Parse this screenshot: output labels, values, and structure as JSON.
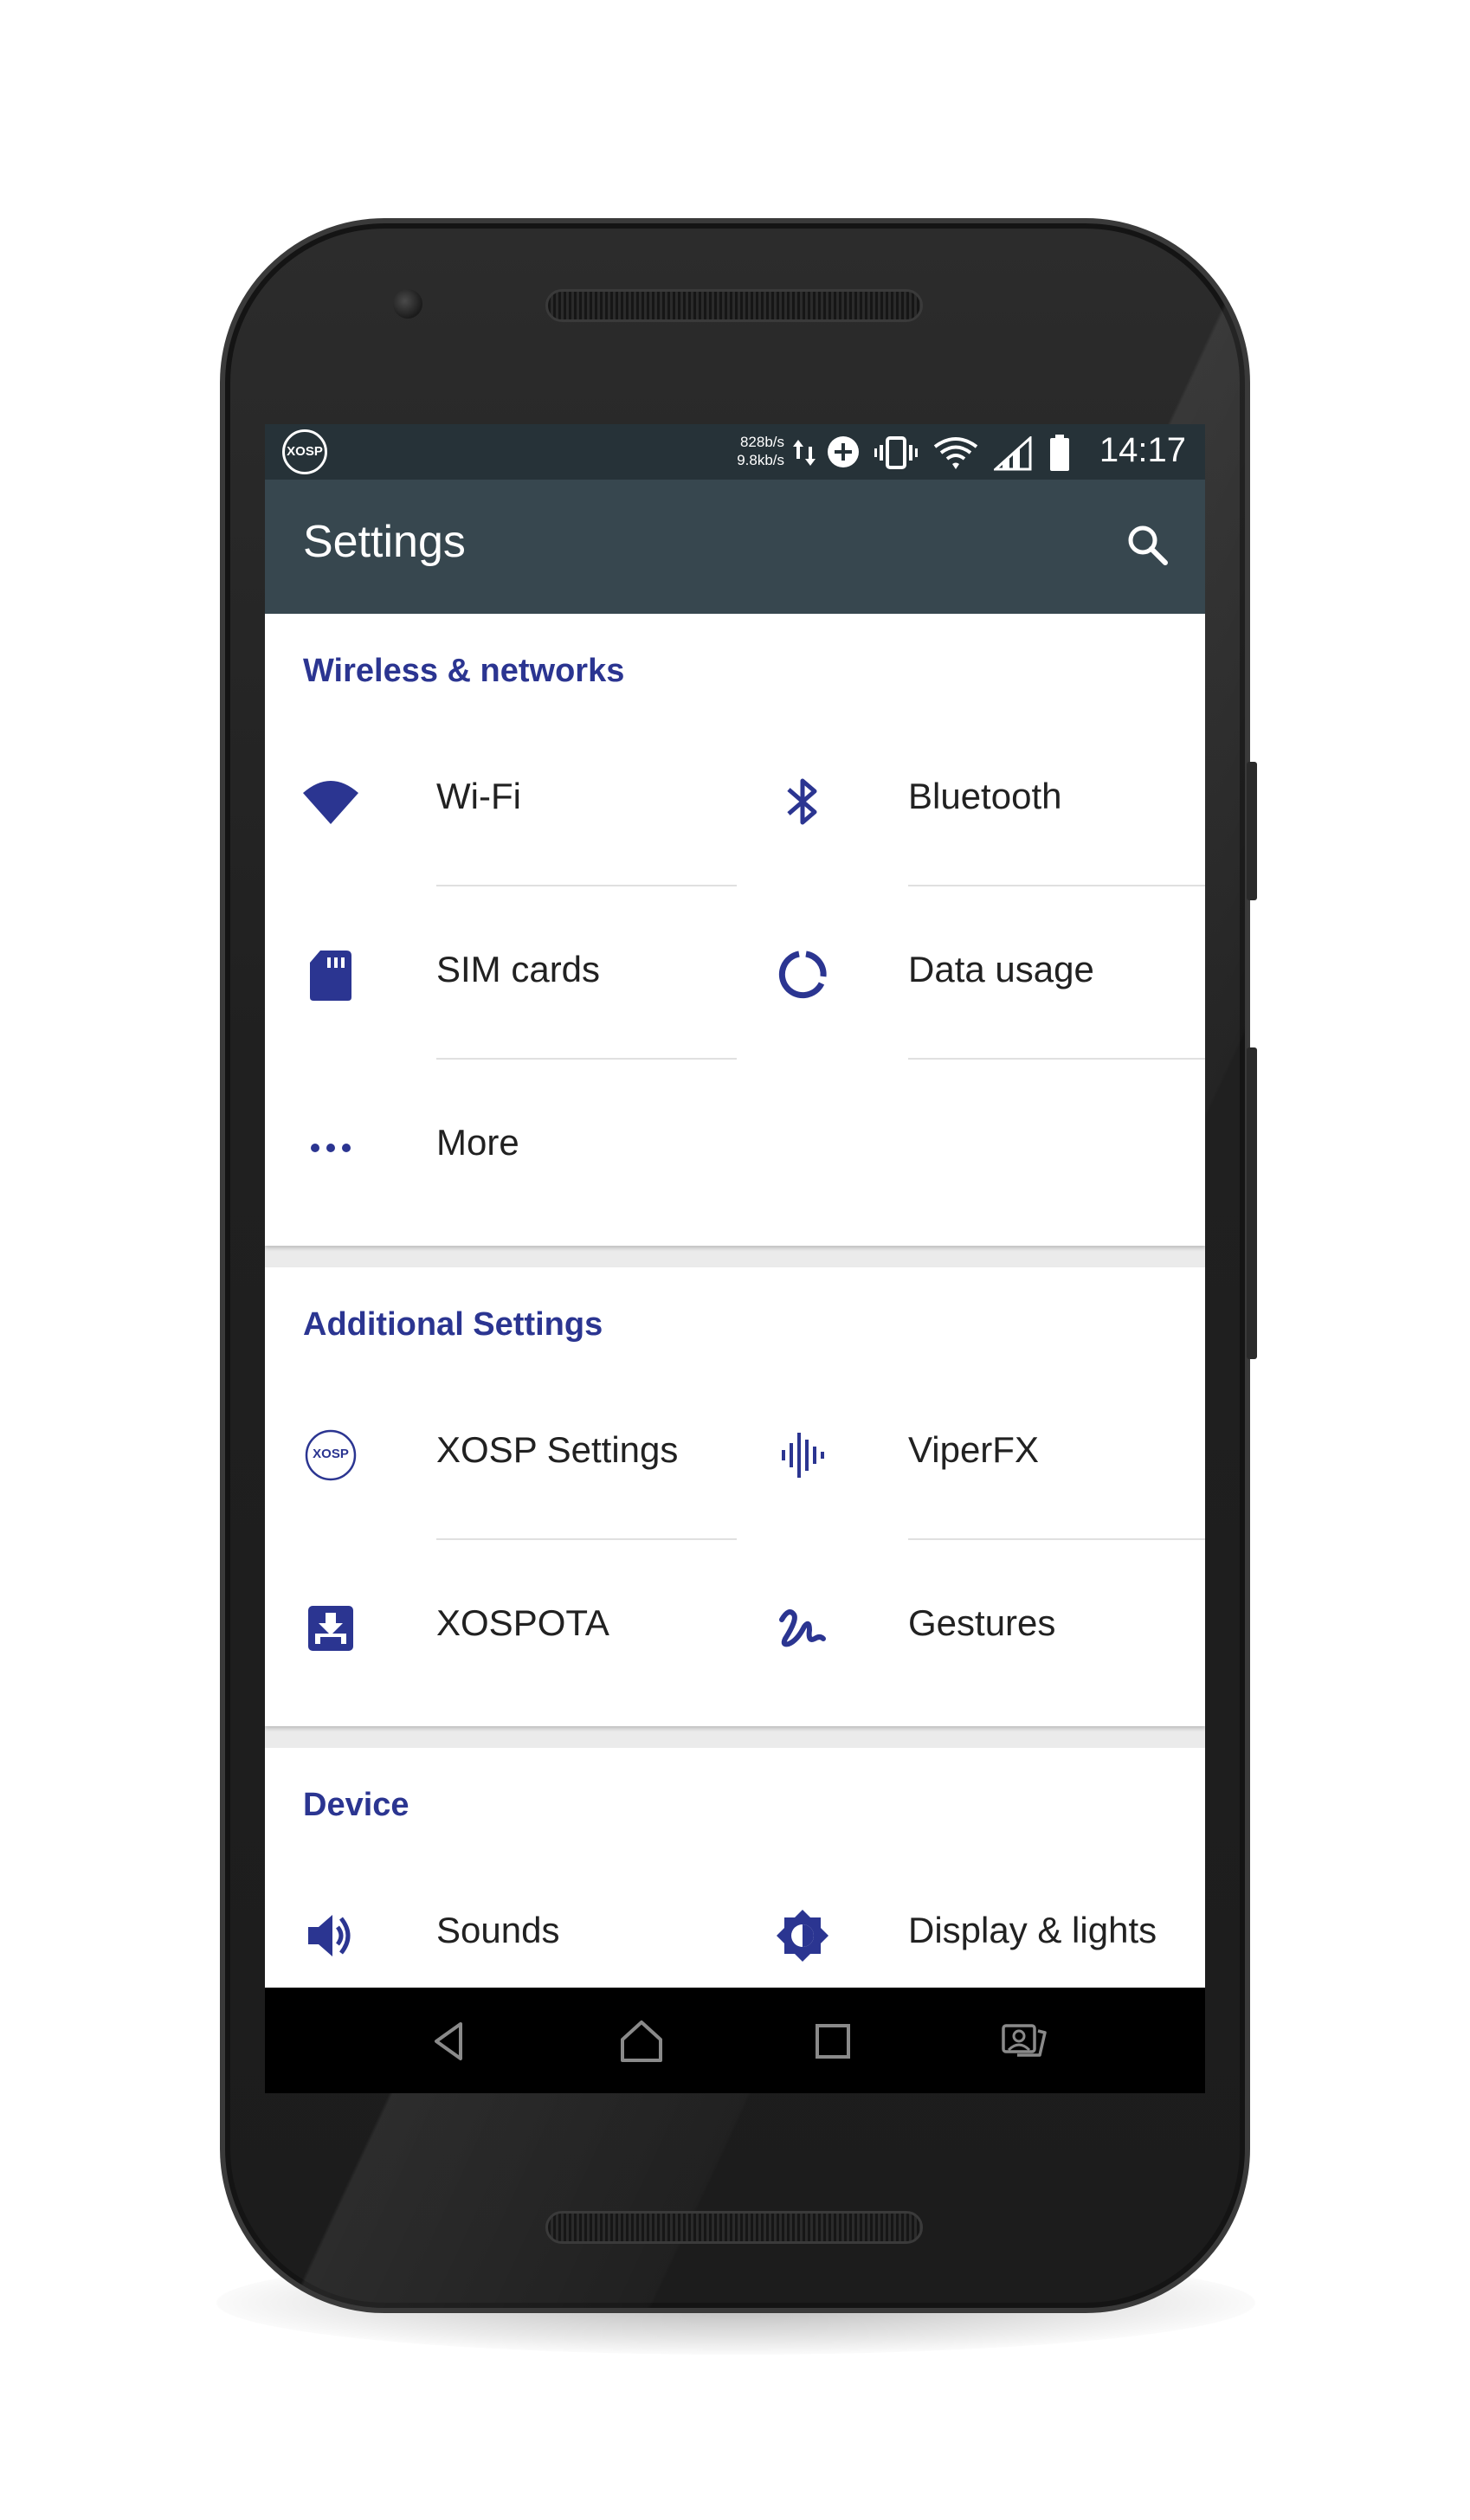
{
  "status_bar": {
    "badge": "XOSP",
    "netspeed_up": "828b/s",
    "netspeed_down": "9.8kb/s",
    "time": "14:17",
    "icons": [
      "data-arrows-icon",
      "add-circle-icon",
      "vibrate-icon",
      "wifi-signal-icon",
      "cell-signal-icon",
      "battery-icon"
    ]
  },
  "app_bar": {
    "title": "Settings",
    "search_icon": "search-icon"
  },
  "sections": [
    {
      "title": "Wireless & networks",
      "items": [
        {
          "label": "Wi-Fi",
          "icon": "wifi-icon"
        },
        {
          "label": "Bluetooth",
          "icon": "bluetooth-icon"
        },
        {
          "label": "SIM cards",
          "icon": "sim-card-icon"
        },
        {
          "label": "Data usage",
          "icon": "data-usage-icon"
        },
        {
          "label": "More",
          "icon": "more-dots-icon"
        }
      ]
    },
    {
      "title": "Additional Settings",
      "items": [
        {
          "label": "XOSP Settings",
          "icon": "xosp-logo-icon",
          "icon_text": "XOSP"
        },
        {
          "label": "ViperFX",
          "icon": "audio-wave-icon"
        },
        {
          "label": "XOSPOTA",
          "icon": "download-box-icon"
        },
        {
          "label": "Gestures",
          "icon": "gesture-icon"
        }
      ]
    },
    {
      "title": "Device",
      "items": [
        {
          "label": "Sounds",
          "icon": "volume-icon"
        },
        {
          "label": "Display & lights",
          "icon": "brightness-icon"
        }
      ]
    }
  ],
  "nav_bar": [
    "back-icon",
    "home-icon",
    "recents-icon",
    "screen-pin-icon"
  ],
  "colors": {
    "accent": "#2b3591",
    "status_bar": "#263238",
    "app_bar": "#37474f",
    "background": "#ebebeb"
  }
}
